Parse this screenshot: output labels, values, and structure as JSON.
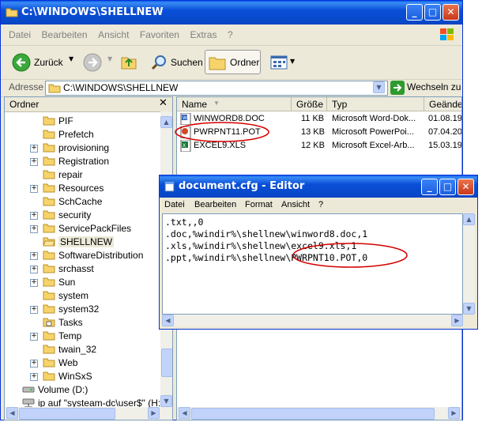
{
  "explorer": {
    "title": "C:\\WINDOWS\\SHELLNEW",
    "menu": [
      "Datei",
      "Bearbeiten",
      "Ansicht",
      "Favoriten",
      "Extras",
      "?"
    ],
    "toolbar": {
      "back": "Zurück",
      "search": "Suchen",
      "folders": "Ordner"
    },
    "address": {
      "label": "Adresse",
      "value": "C:\\WINDOWS\\SHELLNEW",
      "go": "Wechseln zu"
    },
    "folder_pane_title": "Ordner",
    "tree": [
      {
        "label": "PIF",
        "expandable": false
      },
      {
        "label": "Prefetch",
        "expandable": false
      },
      {
        "label": "provisioning",
        "expandable": true
      },
      {
        "label": "Registration",
        "expandable": true
      },
      {
        "label": "repair",
        "expandable": false
      },
      {
        "label": "Resources",
        "expandable": true
      },
      {
        "label": "SchCache",
        "expandable": false
      },
      {
        "label": "security",
        "expandable": true
      },
      {
        "label": "ServicePackFiles",
        "expandable": true
      },
      {
        "label": "SHELLNEW",
        "expandable": false,
        "selected": true
      },
      {
        "label": "SoftwareDistribution",
        "expandable": true
      },
      {
        "label": "srchasst",
        "expandable": true
      },
      {
        "label": "Sun",
        "expandable": true
      },
      {
        "label": "system",
        "expandable": false
      },
      {
        "label": "system32",
        "expandable": true
      },
      {
        "label": "Tasks",
        "expandable": false
      },
      {
        "label": "Temp",
        "expandable": true
      },
      {
        "label": "twain_32",
        "expandable": false
      },
      {
        "label": "Web",
        "expandable": true
      },
      {
        "label": "WinSxS",
        "expandable": true
      }
    ],
    "drives": [
      "Volume (D:)",
      "ip auf \"systeam-dc\\user$\" (H:)"
    ],
    "columns": [
      "Name",
      "Größe",
      "Typ",
      "Geänder"
    ],
    "files": [
      {
        "name": "WINWORD8.DOC",
        "size": "11 KB",
        "type": "Microsoft Word-Dok...",
        "date": "01.08.19",
        "icon": "word-doc-icon"
      },
      {
        "name": "PWRPNT11.POT",
        "size": "13 KB",
        "type": "Microsoft PowerPoi...",
        "date": "07.04.20",
        "icon": "powerpoint-icon"
      },
      {
        "name": "EXCEL9.XLS",
        "size": "12 KB",
        "type": "Microsoft Excel-Arb...",
        "date": "15.03.19",
        "icon": "excel-icon"
      }
    ]
  },
  "notepad": {
    "title": "document.cfg - Editor",
    "menu": [
      "Datei",
      "Bearbeiten",
      "Format",
      "Ansicht",
      "?"
    ],
    "lines": [
      ".txt,,0",
      ".doc,%windir%\\shellnew\\winword8.doc,1",
      ".xls,%windir%\\shellnew\\excel9.xls,1",
      ".ppt,%windir%\\shellnew\\PWRPNT10.POT,0"
    ]
  },
  "colors": {
    "title_blue": "#0a4fd8",
    "annotation_red": "#d40000",
    "window_bg": "#ece9d8"
  }
}
